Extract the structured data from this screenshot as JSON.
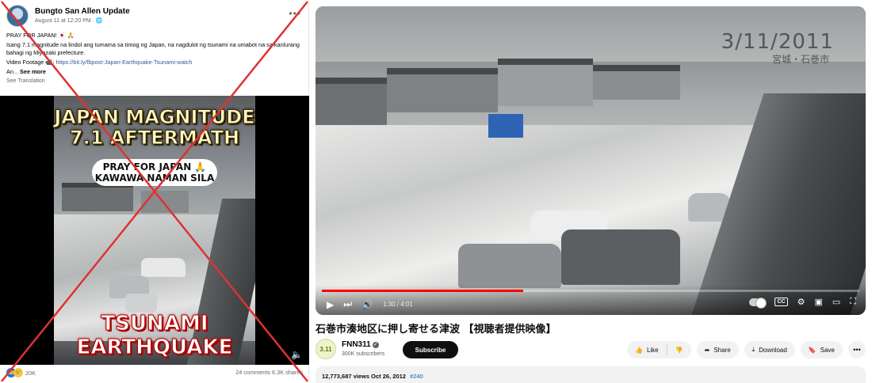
{
  "facebook": {
    "page_name": "Bungto San Allen Update",
    "post_meta": "August 11 at 12:20 PM · ",
    "line1": "PRAY FOR JAPAN! 🇯🇵 🙏",
    "line2": "Isang 7.1 magnitude na lindol ang tumama sa timog ng Japan, na nagdulot ng tsunami na umabot na sa kanlurang bahagi ng Miyazaki prefecture.",
    "video_label": "Video Footage 📹: ",
    "video_link": "https://bit.ly/fbpost-Japan-Earthquake-Tsunami-watch",
    "ellipsis": "An... ",
    "see_more": "See more",
    "see_translation": "See Translation",
    "overlay_top_1": "JAPAN MAGNITUDE",
    "overlay_top_2": "7.1 AFTERMATH",
    "overlay_pill_1": "PRAY FOR JAPAN 🙏",
    "overlay_pill_2": "KAWAWA NAMAN SILA",
    "overlay_bottom_1": "TSUNAMI",
    "overlay_bottom_2": "EARTHQUAKE",
    "reaction_count": "20K",
    "stats": "24 comments  6.3K shares"
  },
  "youtube": {
    "time": "1:30 / 4:01",
    "progress_fraction": 0.374,
    "video_stamp": "3/11/2011",
    "video_stamp_sub": "宮城・石巻市",
    "title": "石巻市湊地区に押し寄せる津波 【視聴者提供映像】",
    "channel_logo_text": "3.11",
    "channel_name": "FNN311",
    "subscribers": "300K subscribers",
    "subscribe": "Subscribe",
    "like": "Like",
    "share": "Share",
    "download": "Download",
    "save": "Save",
    "views_date": "12,773,687 views  Oct 26, 2012",
    "hashtag": "#240"
  },
  "colors": {
    "cross": "#e03131",
    "progress": "#ff0000",
    "fb_link": "#385898",
    "yt_link": "#065fd4"
  }
}
